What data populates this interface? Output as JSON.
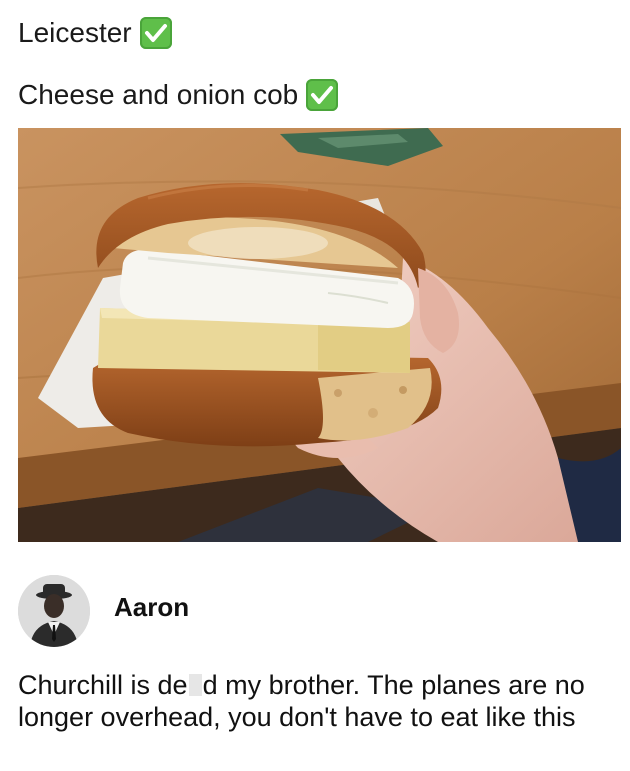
{
  "post": {
    "line1": "Leicester",
    "line2": "Cheese and onion cob",
    "check_color": "#5fbf4a",
    "photo_icon": "cheese-and-onion-cob-photo"
  },
  "comment": {
    "author": "Aaron",
    "avatar_icon": "vintage-portrait-avatar",
    "text_before": "Churchill is de",
    "text_after": "d my brother. The planes are no longer overhead, you don't have to eat like this"
  }
}
